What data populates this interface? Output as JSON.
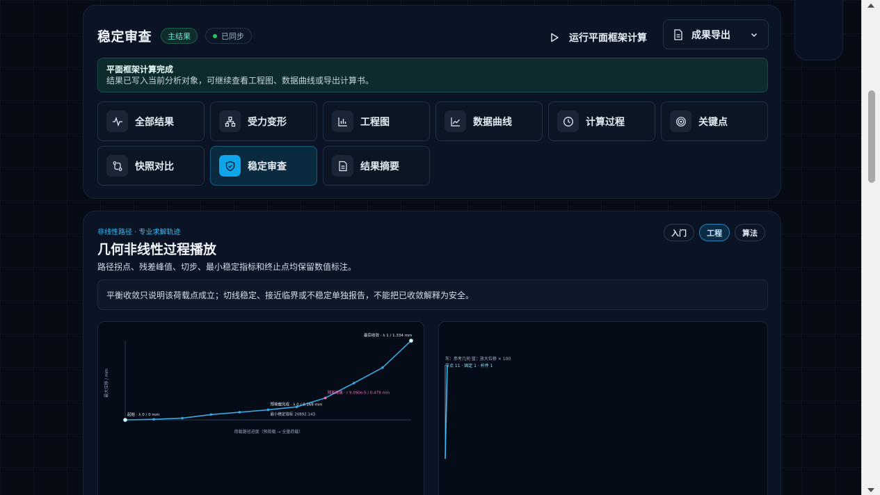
{
  "header": {
    "title": "稳定审查",
    "badge_main": "主结果",
    "badge_sync": "已同步",
    "run_label": "运行平面框架计算",
    "export_label": "成果导出"
  },
  "notice": {
    "title": "平面框架计算完成",
    "text": "结果已写入当前分析对象，可继续查看工程图、数据曲线或导出计算书。"
  },
  "tabs": [
    {
      "label": "全部结果",
      "icon": "pulse-icon"
    },
    {
      "label": "受力变形",
      "icon": "hierarchy-icon"
    },
    {
      "label": "工程图",
      "icon": "bar-chart-icon"
    },
    {
      "label": "数据曲线",
      "icon": "line-chart-icon"
    },
    {
      "label": "计算过程",
      "icon": "clock-icon"
    },
    {
      "label": "关键点",
      "icon": "target-icon"
    },
    {
      "label": "快照对比",
      "icon": "compare-icon"
    },
    {
      "label": "稳定审查",
      "icon": "shield-check-icon",
      "active": true
    },
    {
      "label": "结果摘要",
      "icon": "document-icon"
    }
  ],
  "section": {
    "kicker": "非线性路径 · 专业求解轨迹",
    "title": "几何非线性过程播放",
    "desc": "路径拐点、残差峰值、切步、最小稳定指标和终止点均保留数值标注。",
    "note": "平衡收敛只说明该荷载点成立；切线稳定、接近临界或不稳定单独报告，不能把已收敛解释为安全。",
    "modes": [
      "入门",
      "工程",
      "算法"
    ],
    "active_mode": "工程"
  },
  "colors": {
    "accent": "#0ea5e9",
    "line": "#38a8e0",
    "highlight": "#f472b6",
    "success": "#22c55e"
  },
  "chart_data": {
    "type": "line",
    "title": "",
    "xlabel": "荷载路径进度（预荷载 → 全量荷载）",
    "ylabel": "最大位移 / mm",
    "x": [
      0,
      1,
      2,
      3,
      4,
      5,
      6,
      7,
      8,
      9,
      10
    ],
    "y": [
      0,
      0.01,
      0.03,
      0.09,
      0.13,
      0.17,
      0.22,
      0.37,
      0.62,
      0.88,
      1.334
    ],
    "ylim": [
      0,
      1.334
    ],
    "grid": false,
    "annotations": [
      {
        "text": "起始 · λ 0 / 0 mm",
        "x": 0,
        "y": 0
      },
      {
        "text": "预荷载完成 · λ 0 / 0.168 mm",
        "x": 5,
        "y": 0.17
      },
      {
        "text": "最小稳定指标 20892.143",
        "x": 5,
        "y": 0.17
      },
      {
        "text": "残差峰值 · r 9.090e-5 / 0.479 mm",
        "x": 7,
        "y": 0.37
      },
      {
        "text": "最后收敛 · λ 1 / 1.334 mm",
        "x": 10,
        "y": 1.334
      }
    ]
  },
  "shape_view": {
    "legend": "灰：参考几何 蓝：放大位移 × 100",
    "sublegend": "节点 11 · 固定 1 · 杆件 1"
  }
}
